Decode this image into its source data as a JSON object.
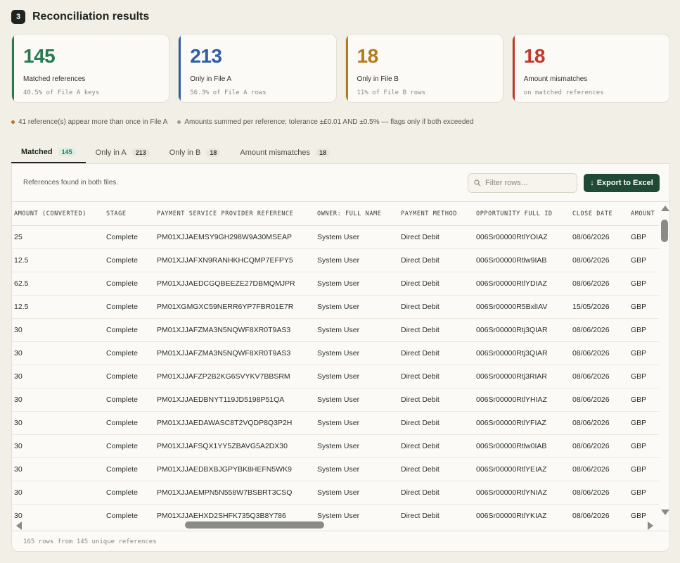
{
  "section": {
    "step": "3",
    "title": "Reconciliation results"
  },
  "cards": [
    {
      "value": "145",
      "label": "Matched references",
      "sub": "40.5% of File A keys",
      "color": "#2a7a50"
    },
    {
      "value": "213",
      "label": "Only in File A",
      "sub": "56.3% of File A rows",
      "color": "#2e5ea8"
    },
    {
      "value": "18",
      "label": "Only in File B",
      "sub": "11% of File B rows",
      "color": "#b57a1c"
    },
    {
      "value": "18",
      "label": "Amount mismatches",
      "sub": "on matched references",
      "color": "#c0392b"
    }
  ],
  "notes": [
    {
      "text": "41 reference(s) appear more than once in File A",
      "color": "#b57a1c"
    },
    {
      "text": "Amounts summed per reference; tolerance ±£0.01 AND ±0.5% — flags only if both exceeded",
      "color": "#9a9a90"
    }
  ],
  "tabs": [
    {
      "label": "Matched",
      "count": "145"
    },
    {
      "label": "Only in A",
      "count": "213"
    },
    {
      "label": "Only in B",
      "count": "18"
    },
    {
      "label": "Amount mismatches",
      "count": "18"
    }
  ],
  "toolbar": {
    "description": "References found in both files.",
    "filter_placeholder": "Filter rows...",
    "export_label": "Export to Excel"
  },
  "table": {
    "headers": [
      "AMOUNT (CONVERTED)",
      "STAGE",
      "PAYMENT SERVICE PROVIDER REFERENCE",
      "OWNER: FULL NAME",
      "PAYMENT METHOD",
      "OPPORTUNITY FULL ID",
      "CLOSE DATE",
      "AMOUNT"
    ],
    "rows": [
      [
        "25",
        "Complete",
        "PM01XJJAEMSY9GH298W9A30MSEAP",
        "System User",
        "Direct Debit",
        "006Sr00000RtlYOIAZ",
        "08/06/2026",
        "GBP"
      ],
      [
        "12.5",
        "Complete",
        "PM01XJJAFXN9RANHKHCQMP7EFPY5",
        "System User",
        "Direct Debit",
        "006Sr00000Rtlw9IAB",
        "08/06/2026",
        "GBP"
      ],
      [
        "62.5",
        "Complete",
        "PM01XJJAEDCGQBEEZE27DBMQMJPR",
        "System User",
        "Direct Debit",
        "006Sr00000RtlYDIAZ",
        "08/06/2026",
        "GBP"
      ],
      [
        "12.5",
        "Complete",
        "PM01XGMGXC59NERR6YP7FBR01E7R",
        "System User",
        "Direct Debit",
        "006Sr00000R5BxlIAV",
        "15/05/2026",
        "GBP"
      ],
      [
        "30",
        "Complete",
        "PM01XJJAFZMA3N5NQWF8XR0T9AS3",
        "System User",
        "Direct Debit",
        "006Sr00000Rtj3QIAR",
        "08/06/2026",
        "GBP"
      ],
      [
        "30",
        "Complete",
        "PM01XJJAFZMA3N5NQWF8XR0T9AS3",
        "System User",
        "Direct Debit",
        "006Sr00000Rtj3QIAR",
        "08/06/2026",
        "GBP"
      ],
      [
        "30",
        "Complete",
        "PM01XJJAFZP2B2KG6SVYKV7BBSRM",
        "System User",
        "Direct Debit",
        "006Sr00000Rtj3RIAR",
        "08/06/2026",
        "GBP"
      ],
      [
        "30",
        "Complete",
        "PM01XJJAEDBNYT119JD5198P51QA",
        "System User",
        "Direct Debit",
        "006Sr00000RtlYHIAZ",
        "08/06/2026",
        "GBP"
      ],
      [
        "30",
        "Complete",
        "PM01XJJAEDAWASC8T2VQDP8Q3P2H",
        "System User",
        "Direct Debit",
        "006Sr00000RtlYFIAZ",
        "08/06/2026",
        "GBP"
      ],
      [
        "30",
        "Complete",
        "PM01XJJAFSQX1YY5ZBAVG5A2DX30",
        "System User",
        "Direct Debit",
        "006Sr00000Rtlw0IAB",
        "08/06/2026",
        "GBP"
      ],
      [
        "30",
        "Complete",
        "PM01XJJAEDBXBJGPYBK8HEFN5WK9",
        "System User",
        "Direct Debit",
        "006Sr00000RtlYEIAZ",
        "08/06/2026",
        "GBP"
      ],
      [
        "30",
        "Complete",
        "PM01XJJAEMPN5N558W7BSBRT3CSQ",
        "System User",
        "Direct Debit",
        "006Sr00000RtlYNIAZ",
        "08/06/2026",
        "GBP"
      ],
      [
        "30",
        "Complete",
        "PM01XJJAEHXD2SHFK735Q3B8Y786",
        "System User",
        "Direct Debit",
        "006Sr00000RtlYKIAZ",
        "08/06/2026",
        "GBP"
      ]
    ]
  },
  "footer": {
    "text": "165 rows from 145 unique references"
  }
}
